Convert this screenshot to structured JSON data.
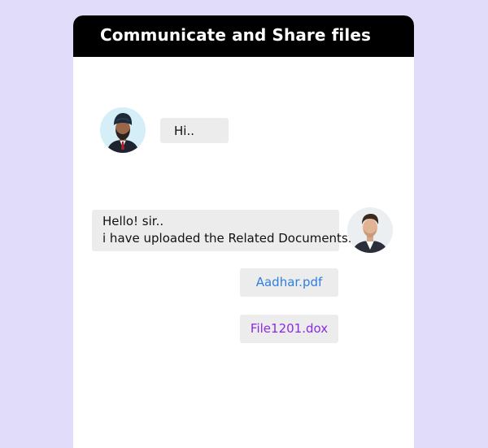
{
  "card": {
    "title": "Communicate and Share files"
  },
  "messages": {
    "incoming": {
      "text": "Hi.."
    },
    "outgoing": {
      "line1": "Hello! sir..",
      "line2": "i have uploaded the Related Documents."
    }
  },
  "attachments": [
    {
      "name": "Aadhar.pdf",
      "color": "#2f7fe0"
    },
    {
      "name": "File1201.dox",
      "color": "#8a2be2"
    }
  ],
  "colors": {
    "background": "#e2dcfb",
    "header": "#000000",
    "bubble": "#ececec"
  }
}
